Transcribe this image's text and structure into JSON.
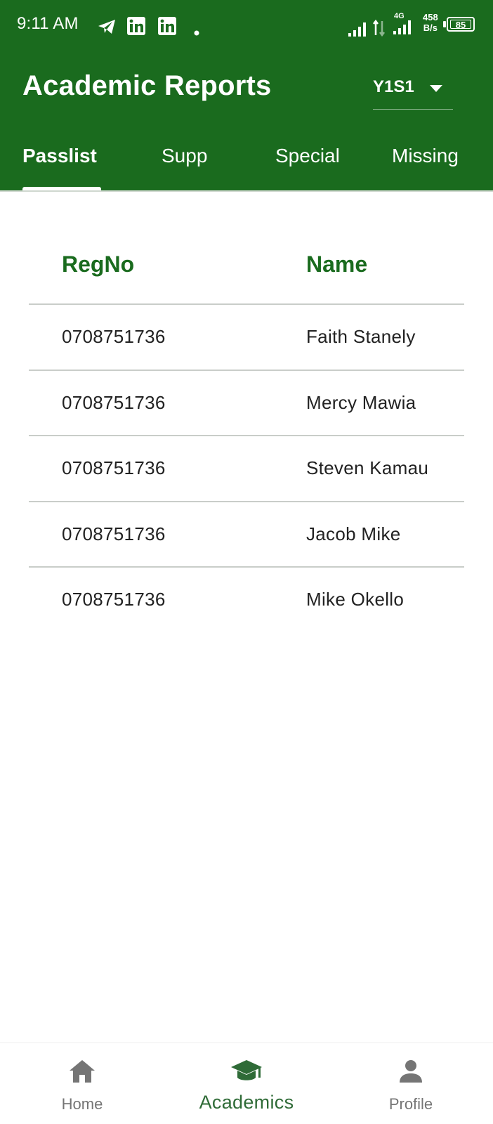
{
  "status_bar": {
    "time": "9:11 AM",
    "network_type": "4G",
    "speed_value": "458",
    "speed_unit": "B/s",
    "battery": "85",
    "icons": [
      "telegram-icon",
      "linkedin-icon",
      "linkedin-icon",
      "dot-icon",
      "signal-icon",
      "data-arrows-icon",
      "signal-4g-icon",
      "battery-icon"
    ]
  },
  "header": {
    "title": "Academic Reports",
    "year_select": {
      "selected": "Y1S1"
    }
  },
  "tabs": [
    {
      "label": "Passlist",
      "active": true
    },
    {
      "label": "Supp",
      "active": false
    },
    {
      "label": "Special",
      "active": false
    },
    {
      "label": "Missing",
      "active": false
    }
  ],
  "table": {
    "headers": [
      "RegNo",
      "Name"
    ],
    "rows": [
      {
        "regno": "0708751736",
        "name": "Faith Stanely"
      },
      {
        "regno": "0708751736",
        "name": "Mercy Mawia"
      },
      {
        "regno": "0708751736",
        "name": "Steven Kamau"
      },
      {
        "regno": "0708751736",
        "name": "Jacob Mike"
      },
      {
        "regno": "0708751736",
        "name": "Mike Okello"
      }
    ]
  },
  "bottom_nav": [
    {
      "label": "Home",
      "icon": "home-icon",
      "active": false
    },
    {
      "label": "Academics",
      "icon": "graduation-cap-icon",
      "active": true
    },
    {
      "label": "Profile",
      "icon": "person-icon",
      "active": false
    }
  ],
  "colors": {
    "primary": "#1a6b1e",
    "active_nav": "#2f6b37",
    "inactive_nav": "#757575"
  }
}
